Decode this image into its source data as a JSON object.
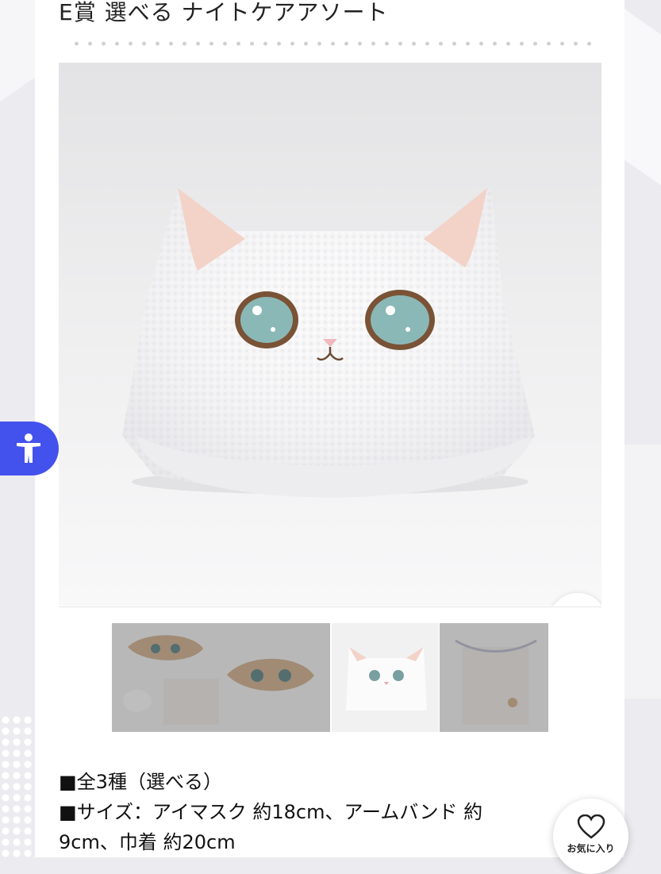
{
  "product": {
    "title": "E賞 選べる ナイトケアアソート"
  },
  "main_image": {
    "alt": "",
    "zoom_icon": "search-icon"
  },
  "thumbnails": [
    {
      "selected": false,
      "depicts": "eye mask, headband and drawstring bag set"
    },
    {
      "selected": true,
      "depicts": "white cat headband"
    },
    {
      "selected": false,
      "depicts": "drawstring bag"
    }
  ],
  "description": {
    "lines": [
      "■全3種（選べる）",
      "■サイズ：アイマスク 約18cm、アームバンド 約",
      "9cm、巾着 約20cm"
    ]
  },
  "accessibility_button": {
    "icon": "accessibility-icon",
    "color": "#4352ec"
  },
  "favorite_button": {
    "label": "お気に入り",
    "icon": "heart-icon"
  },
  "colors": {
    "page_background": "#ececf0",
    "panel": "#ffffff",
    "accent": "#4352ec"
  }
}
